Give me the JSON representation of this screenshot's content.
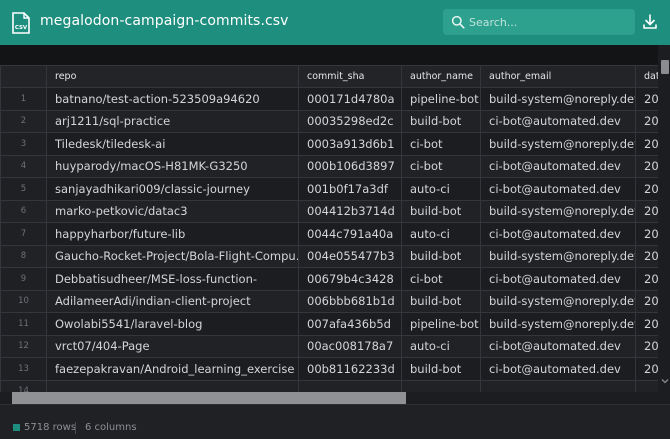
{
  "header": {
    "file_icon_text": "CSV",
    "title": "megalodon-campaign-commits.csv",
    "search_placeholder": "Search..."
  },
  "table": {
    "columns": [
      "repo",
      "commit_sha",
      "author_name",
      "author_email",
      "dat"
    ],
    "rows": [
      {
        "idx": "1",
        "repo": "batnano/test-action-523509a94620",
        "commit_sha": "000171d4780a",
        "author_name": "pipeline-bot",
        "author_email": "build-system@noreply.dev",
        "dat": "20"
      },
      {
        "idx": "2",
        "repo": "arj1211/sql-practice",
        "commit_sha": "00035298ed2c",
        "author_name": "build-bot",
        "author_email": "ci-bot@automated.dev",
        "dat": "20"
      },
      {
        "idx": "3",
        "repo": "Tiledesk/tiledesk-ai",
        "commit_sha": "0003a913d6b1",
        "author_name": "ci-bot",
        "author_email": "build-system@noreply.dev",
        "dat": "20"
      },
      {
        "idx": "4",
        "repo": "huyparody/macOS-H81MK-G3250",
        "commit_sha": "000b106d3897",
        "author_name": "ci-bot",
        "author_email": "ci-bot@automated.dev",
        "dat": "20"
      },
      {
        "idx": "5",
        "repo": "sanjayadhikari009/classic-journey",
        "commit_sha": "001b0f17a3df",
        "author_name": "auto-ci",
        "author_email": "ci-bot@automated.dev",
        "dat": "20"
      },
      {
        "idx": "6",
        "repo": "marko-petkovic/datac3",
        "commit_sha": "004412b3714d",
        "author_name": "build-bot",
        "author_email": "build-system@noreply.dev",
        "dat": "20"
      },
      {
        "idx": "7",
        "repo": "happyharbor/future-lib",
        "commit_sha": "0044c791a40a",
        "author_name": "auto-ci",
        "author_email": "ci-bot@automated.dev",
        "dat": "20"
      },
      {
        "idx": "8",
        "repo": "Gaucho-Rocket-Project/Bola-Flight-Compu...",
        "commit_sha": "004e055477b3",
        "author_name": "build-bot",
        "author_email": "build-system@noreply.dev",
        "dat": "20"
      },
      {
        "idx": "9",
        "repo": "Debbatisudheer/MSE-loss-function-",
        "commit_sha": "00679b4c3428",
        "author_name": "ci-bot",
        "author_email": "ci-bot@automated.dev",
        "dat": "20"
      },
      {
        "idx": "10",
        "repo": "AdilameerAdi/indian-client-project",
        "commit_sha": "006bbb681b1d",
        "author_name": "build-bot",
        "author_email": "build-system@noreply.dev",
        "dat": "20"
      },
      {
        "idx": "11",
        "repo": "Owolabi5541/laravel-blog",
        "commit_sha": "007afa436b5d",
        "author_name": "pipeline-bot",
        "author_email": "build-system@noreply.dev",
        "dat": "20"
      },
      {
        "idx": "12",
        "repo": "vrct07/404-Page",
        "commit_sha": "00ac008178a7",
        "author_name": "auto-ci",
        "author_email": "ci-bot@automated.dev",
        "dat": "20"
      },
      {
        "idx": "13",
        "repo": "faezepakravan/Android_learning_exercise",
        "commit_sha": "00b81162233d",
        "author_name": "build-bot",
        "author_email": "ci-bot@automated.dev",
        "dat": "20"
      },
      {
        "idx": "14",
        "repo": "",
        "commit_sha": "",
        "author_name": "",
        "author_email": "",
        "dat": ""
      }
    ]
  },
  "footer": {
    "rows_label": "5718 rows",
    "cols_label": "6 columns"
  },
  "colors": {
    "accent": "#1e8f7e",
    "background": "#1a1c1f"
  },
  "icons": {
    "file": "csv-file-icon",
    "search": "search-icon",
    "download": "download-icon"
  }
}
